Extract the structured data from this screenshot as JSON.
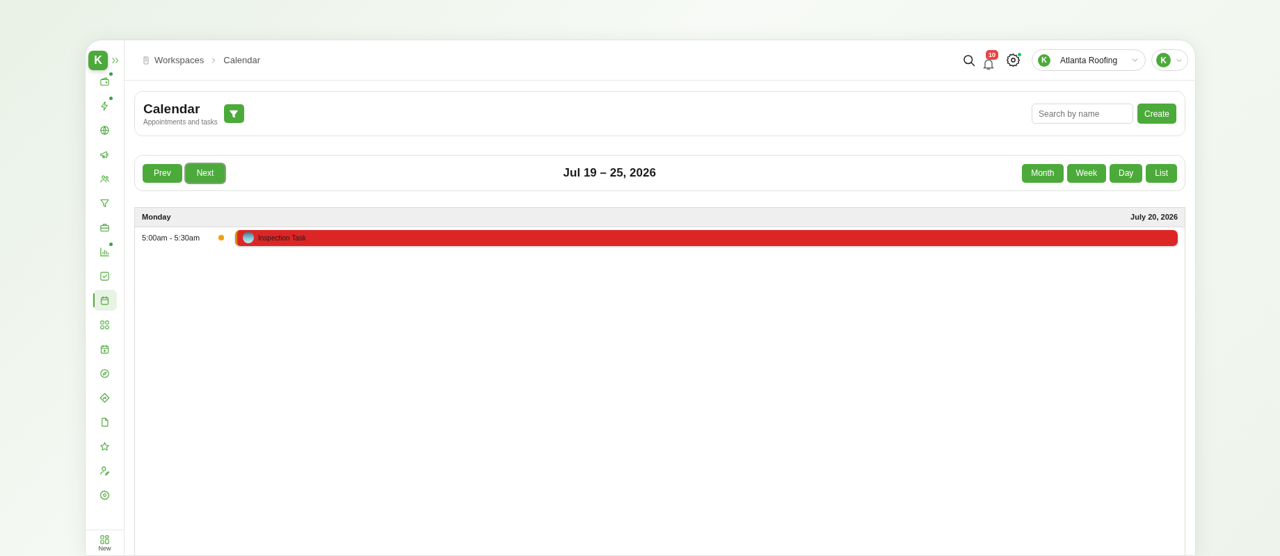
{
  "sidebar": {
    "logo": "K",
    "items": [
      {
        "selected": false,
        "dot": true
      },
      {
        "selected": false,
        "dot": true
      },
      {
        "selected": false,
        "dot": false
      },
      {
        "selected": false,
        "dot": false
      },
      {
        "selected": false,
        "dot": false
      },
      {
        "selected": false,
        "dot": false
      },
      {
        "selected": false,
        "dot": false
      },
      {
        "selected": false,
        "dot": true
      },
      {
        "selected": false,
        "dot": false
      },
      {
        "selected": true,
        "dot": false
      },
      {
        "selected": false,
        "dot": false
      },
      {
        "selected": false,
        "dot": false
      },
      {
        "selected": false,
        "dot": false
      },
      {
        "selected": false,
        "dot": false
      },
      {
        "selected": false,
        "dot": false
      },
      {
        "selected": false,
        "dot": false
      },
      {
        "selected": false,
        "dot": false
      },
      {
        "selected": false,
        "dot": false
      }
    ],
    "bottom": {
      "label": "New"
    }
  },
  "header": {
    "breadcrumb": [
      {
        "label": "Workspaces"
      },
      {
        "label": "Calendar"
      }
    ],
    "notifications": "10",
    "settings_dot": true,
    "account": {
      "logo": "K",
      "name": "Atlanta Roofing"
    },
    "avatar": {
      "logo": "K"
    }
  },
  "page": {
    "title": "Calendar",
    "subtitle": "Appointments and tasks",
    "search": {
      "placeholder": "Search by name"
    },
    "create": "Create"
  },
  "nav": {
    "prev": {
      "label": "Prev",
      "focused": false
    },
    "next": {
      "label": "Next",
      "focused": true
    },
    "range": "Jul 19 – 25, 2026",
    "views": [
      {
        "label": "Month",
        "selected": false
      },
      {
        "label": "Week",
        "selected": false
      },
      {
        "label": "Day",
        "selected": false
      },
      {
        "label": "List",
        "selected": false
      }
    ]
  },
  "days": [
    {
      "day": "Monday",
      "date": "July 20, 2026",
      "events": [
        {
          "time": "5:00am - 5:30am",
          "status": {
            "color": "#f59e0b"
          },
          "color": "#dc2626",
          "title": "Inspection Task"
        }
      ]
    }
  ]
}
